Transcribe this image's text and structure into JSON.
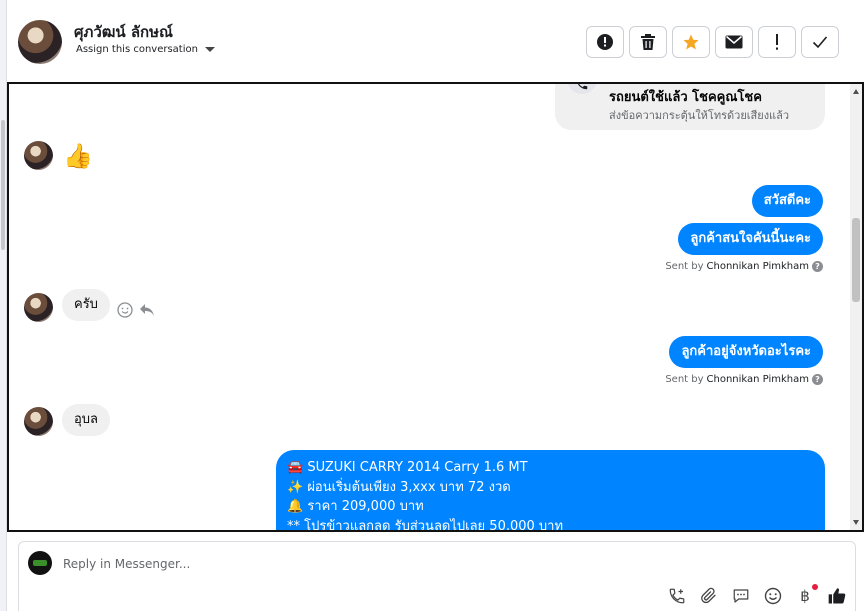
{
  "header": {
    "contact_name": "ศุภวัฒน์ ลักษณ์",
    "assign_label": "Assign this conversation",
    "buttons": [
      "spam-alert",
      "delete",
      "star",
      "mark-unread",
      "important",
      "done"
    ],
    "star_color": "#f5a623"
  },
  "chat": {
    "top_card": {
      "title": "รถยนต์ใช้แล้ว โชคคูณโชค",
      "subtitle": "ส่งข้อความกระตุ้นให้โทรด้วยเสียงแล้ว"
    },
    "thumbs_emoji": "👍",
    "messages": [
      {
        "dir": "out",
        "text": "สวัสดีคะ"
      },
      {
        "dir": "out",
        "text": "ลูกค้าสนใจคันนี้นะคะ"
      },
      {
        "dir": "in",
        "text": "ครับ"
      },
      {
        "dir": "out",
        "text": "ลูกค้าอยู่จังหวัดอะไรคะ"
      },
      {
        "dir": "in",
        "text": "อุบล"
      }
    ],
    "sent_by_prefix": "Sent by",
    "sent_by_name": "Chonnikan Pimkham",
    "long_message_lines": [
      "🚘 SUZUKI CARRY 2014 Carry 1.6 MT",
      "✨ ผ่อนเริ่มต้นเพียง 3,xxx บาท 72 งวด",
      "🔔  ราคา 209,000 บาท",
      "**  โปรข้าวแลกลด รับส่วนลดไปเลย 50,000 บาท"
    ],
    "bubble_color": "#0084ff"
  },
  "composer": {
    "placeholder": "Reply in Messenger...",
    "baht_symbol": "฿",
    "tools": [
      "add-call",
      "attach",
      "saved-reply",
      "emoji",
      "payment",
      "like"
    ]
  }
}
